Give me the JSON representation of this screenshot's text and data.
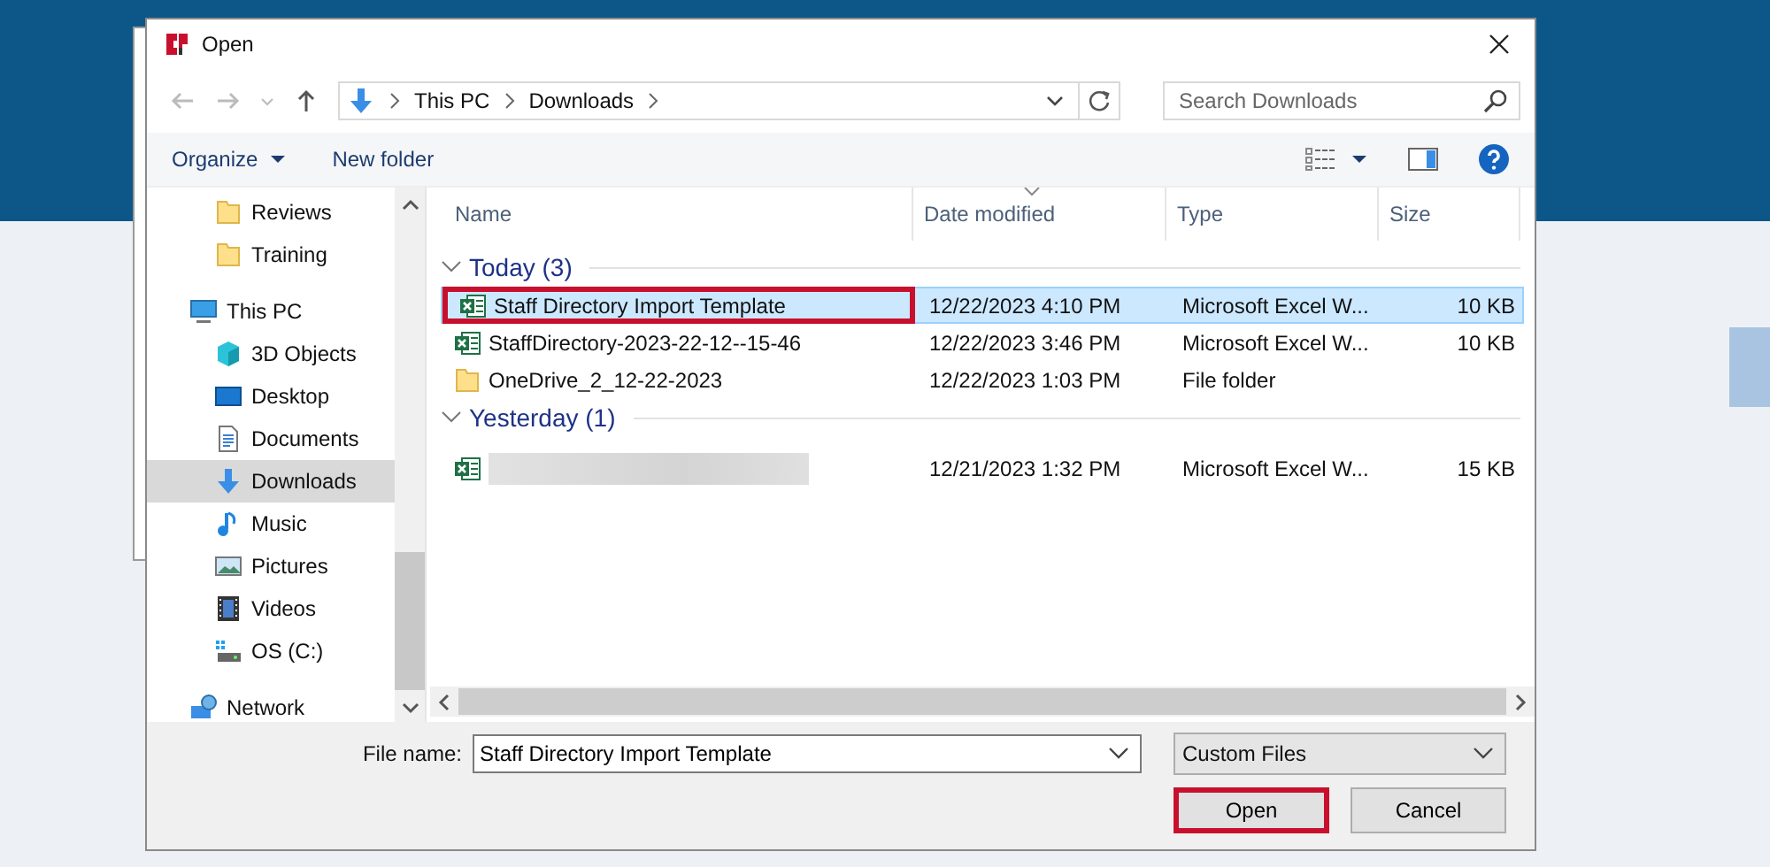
{
  "window": {
    "title": "Open"
  },
  "address": {
    "crumbs": [
      "This PC",
      "Downloads"
    ]
  },
  "search": {
    "placeholder": "Search Downloads"
  },
  "toolbar": {
    "buttons": [
      "Organize",
      "New folder"
    ]
  },
  "sidebar": {
    "items": [
      {
        "children": [
          {
            "label": "Reviews",
            "kind": "folder",
            "selected": false
          },
          {
            "label": "Training",
            "kind": "folder",
            "selected": false
          }
        ]
      },
      {
        "label": "This PC",
        "kind": "pc",
        "selected": false,
        "children": [
          {
            "label": "3D Objects",
            "kind": "cube",
            "selected": false
          },
          {
            "label": "Desktop",
            "kind": "desktop",
            "selected": false
          },
          {
            "label": "Documents",
            "kind": "document",
            "selected": false
          },
          {
            "label": "Downloads",
            "kind": "download",
            "selected": true
          },
          {
            "label": "Music",
            "kind": "music",
            "selected": false
          },
          {
            "label": "Pictures",
            "kind": "picture",
            "selected": false
          },
          {
            "label": "Videos",
            "kind": "video",
            "selected": false
          },
          {
            "label": "OS (C:)",
            "kind": "drive",
            "selected": false
          }
        ]
      },
      {
        "label": "Network",
        "kind": "network",
        "selected": false
      }
    ]
  },
  "table": {
    "columns": [
      {
        "label": "Name",
        "sorted": false
      },
      {
        "label": "Date modified",
        "sorted": true
      },
      {
        "label": "Type",
        "sorted": false
      },
      {
        "label": "Size",
        "sorted": false
      }
    ],
    "groups": [
      {
        "label": "Today (3)",
        "expanded": true,
        "rows": [
          {
            "kind": "excel",
            "name": "Staff Directory Import Template",
            "date": "12/22/2023 4:10 PM",
            "type": "Microsoft Excel W...",
            "size": "10 KB",
            "selected": true,
            "highlighted": true
          },
          {
            "kind": "excel",
            "name": "StaffDirectory-2023-22-12--15-46",
            "date": "12/22/2023 3:46 PM",
            "type": "Microsoft Excel W...",
            "size": "10 KB",
            "selected": false,
            "highlighted": false
          },
          {
            "kind": "folder",
            "name": "OneDrive_2_12-22-2023",
            "date": "12/22/2023 1:03 PM",
            "type": "File folder",
            "selected": false,
            "highlighted": false
          }
        ]
      },
      {
        "label": "Yesterday (1)",
        "expanded": true,
        "rows": [
          {
            "kind": "excel",
            "redacted": true,
            "date": "12/21/2023 1:32 PM",
            "type": "Microsoft Excel W...",
            "size": "15 KB",
            "selected": false,
            "highlighted": false
          }
        ]
      }
    ]
  },
  "footer": {
    "file_name_label": "File name:",
    "file_name": "Staff Directory Import Template",
    "file_type": "Custom Files",
    "buttons": [
      {
        "label": "Open",
        "highlighted": true
      },
      {
        "label": "Cancel",
        "highlighted": false
      }
    ]
  }
}
